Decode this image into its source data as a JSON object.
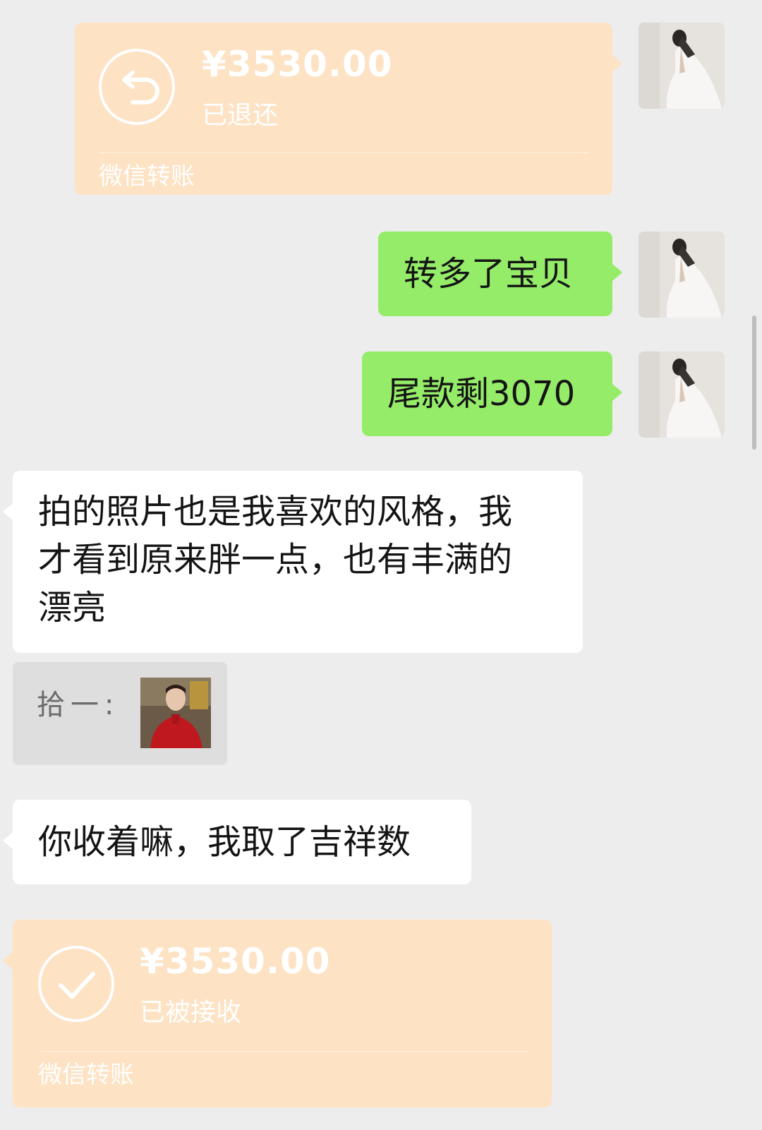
{
  "messages": {
    "transfer_refunded": {
      "amount": "¥3530.00",
      "status": "已退还",
      "footer": "微信转账"
    },
    "sent_1": {
      "text": "转多了宝贝"
    },
    "sent_2": {
      "text": "尾款剩3070"
    },
    "received_1": {
      "line1": "拍的照片也是我喜欢的风格，我",
      "line2": "才看到原来胖一点，也有丰满的",
      "line3": "漂亮"
    },
    "quote": {
      "text": "拾一:"
    },
    "received_2": {
      "text": "你收着嘛，我取了吉祥数"
    },
    "transfer_received": {
      "amount": "¥3530.00",
      "status": "已被接收",
      "footer": "微信转账"
    }
  },
  "colors": {
    "background": "#ededed",
    "sent_bubble": "#95ec69",
    "received_bubble": "#ffffff",
    "transfer_card": "#fde2c4",
    "quote_block": "#dedede"
  },
  "icons": {
    "refund": "return-arrow-icon",
    "received": "checkmark-icon"
  }
}
